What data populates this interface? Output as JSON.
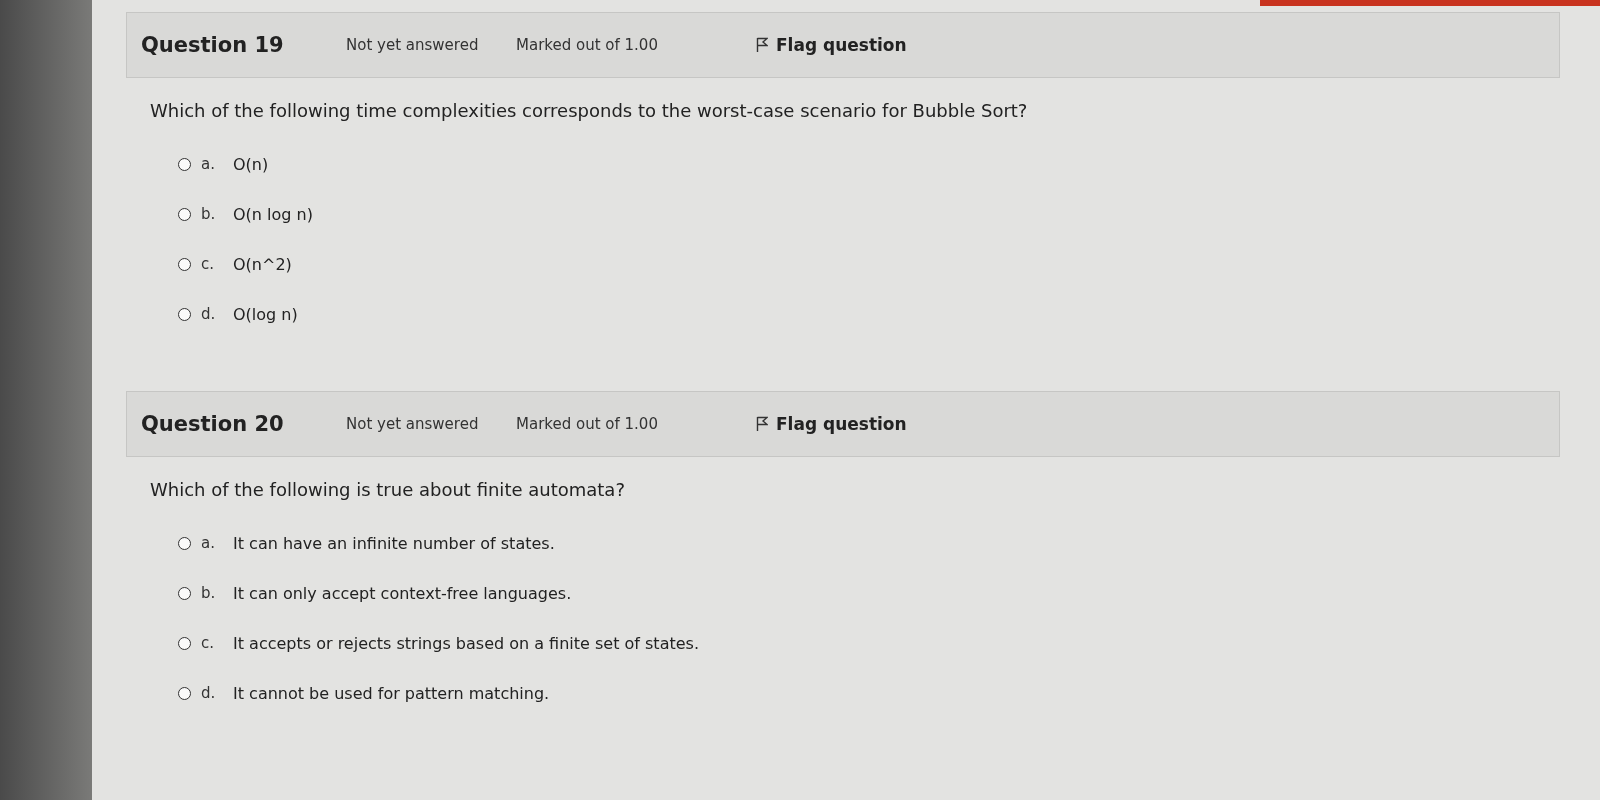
{
  "questions": [
    {
      "number": "Question 19",
      "status": "Not yet answered",
      "marks": "Marked out of 1.00",
      "flag": "Flag question",
      "text": "Which of the following time complexities corresponds to the worst-case scenario for Bubble Sort?",
      "options": [
        {
          "letter": "a.",
          "text": "O(n)",
          "selected": false
        },
        {
          "letter": "b.",
          "text": "O(n log n)",
          "selected": false
        },
        {
          "letter": "c.",
          "text": "O(n^2)",
          "selected": false
        },
        {
          "letter": "d.",
          "text": "O(log n)",
          "selected": false
        }
      ]
    },
    {
      "number": "Question 20",
      "status": "Not yet answered",
      "marks": "Marked out of 1.00",
      "flag": "Flag question",
      "text": "Which of the following is true about finite automata?",
      "options": [
        {
          "letter": "a.",
          "text": "It can have an infinite number of states.",
          "selected": false
        },
        {
          "letter": "b.",
          "text": "It can only accept context-free languages.",
          "selected": false
        },
        {
          "letter": "c.",
          "text": "It accepts or rejects strings based on a finite set of states.",
          "selected": false
        },
        {
          "letter": "d.",
          "text": "It cannot be used for pattern matching.",
          "selected": false
        }
      ]
    }
  ]
}
